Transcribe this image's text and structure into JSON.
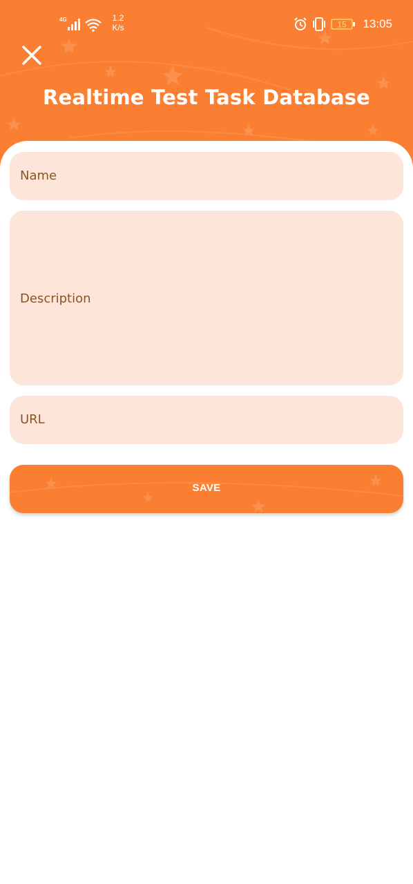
{
  "status_bar": {
    "network": "4G",
    "speed_value": "1.2",
    "speed_unit": "K/s",
    "battery": "15",
    "time": "13:05"
  },
  "header": {
    "title": "Realtime Test Task Database",
    "close_icon": "close-icon"
  },
  "form": {
    "name_label": "Name",
    "description_label": "Description",
    "url_label": "URL",
    "save_label": "SAVE"
  },
  "colors": {
    "accent": "#fb7f33",
    "field_bg": "#fde6d9",
    "label_text": "#8a5420",
    "background": "#ffffff"
  }
}
